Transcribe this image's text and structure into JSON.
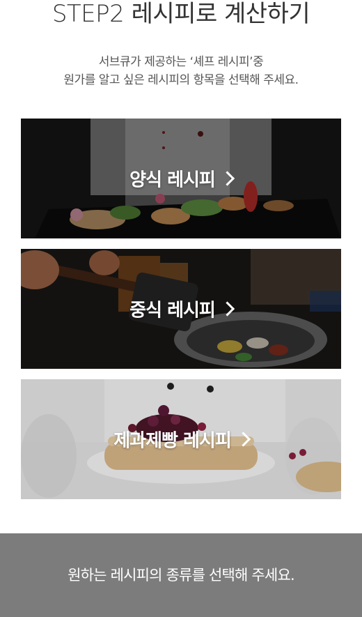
{
  "header": {
    "title": "STEP2 레시피로 계산하기",
    "desc_line1": "서브큐가 제공하는 ‘셰프 레시피’중",
    "desc_line2": "원가를 알고 싶은 레시피의 항목을 선택해 주세요."
  },
  "cards": [
    {
      "label": "양식 레시피",
      "theme": "dark"
    },
    {
      "label": "중식 레시피",
      "theme": "dark"
    },
    {
      "label": "제과제빵 레시피",
      "theme": "light"
    }
  ],
  "footer": {
    "text": "원하는 레시피의 종류를 선택해 주세요.",
    "bg_color": "#7d7c7d"
  }
}
